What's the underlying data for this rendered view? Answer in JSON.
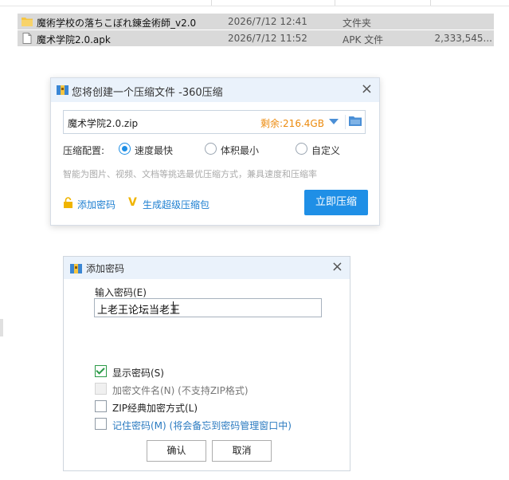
{
  "explorer": {
    "files": [
      {
        "name": "魔術学校の落ちこぼれ錬金術師_v2.0",
        "date": "2026/7/12 12:41",
        "type": "文件夹",
        "size": "",
        "icon": "folder-icon"
      },
      {
        "name": "魔术学院2.0.apk",
        "date": "2026/7/12 11:52",
        "type": "APK 文件",
        "size": "2,333,545...",
        "icon": "file-icon"
      }
    ]
  },
  "compress_dialog": {
    "title": "您将创建一个压缩文件 -360压缩",
    "close_label": "×",
    "archive_name": "魔术学院2.0.zip",
    "free_space": "剩余:216.4GB",
    "config_label": "压缩配置:",
    "options": [
      {
        "label": "速度最快",
        "selected": true
      },
      {
        "label": "体积最小",
        "selected": false
      },
      {
        "label": "自定义",
        "selected": false
      }
    ],
    "hint": "智能为图片、视频、文档等挑选最优压缩方式，兼具速度和压缩率",
    "add_password_label": "添加密码",
    "super_package_label": "生成超级压缩包",
    "compress_button": "立即压缩",
    "accent_color": "#1f8fe6"
  },
  "password_dialog": {
    "title": "添加密码",
    "close_label": "×",
    "input_label": "输入密码(E)",
    "password_value": "上老王论坛当老王",
    "checkboxes": [
      {
        "label": "显示密码(S)",
        "checked": true,
        "disabled": false
      },
      {
        "label": "加密文件名(N) (不支持ZIP格式)",
        "checked": false,
        "disabled": true
      },
      {
        "label": "ZIP经典加密方式(L)",
        "checked": false,
        "disabled": false
      },
      {
        "label": "记住密码(M) (将会备忘到密码管理窗口中)",
        "checked": false,
        "disabled": false
      }
    ],
    "ok_button": "确认",
    "cancel_button": "取消"
  }
}
